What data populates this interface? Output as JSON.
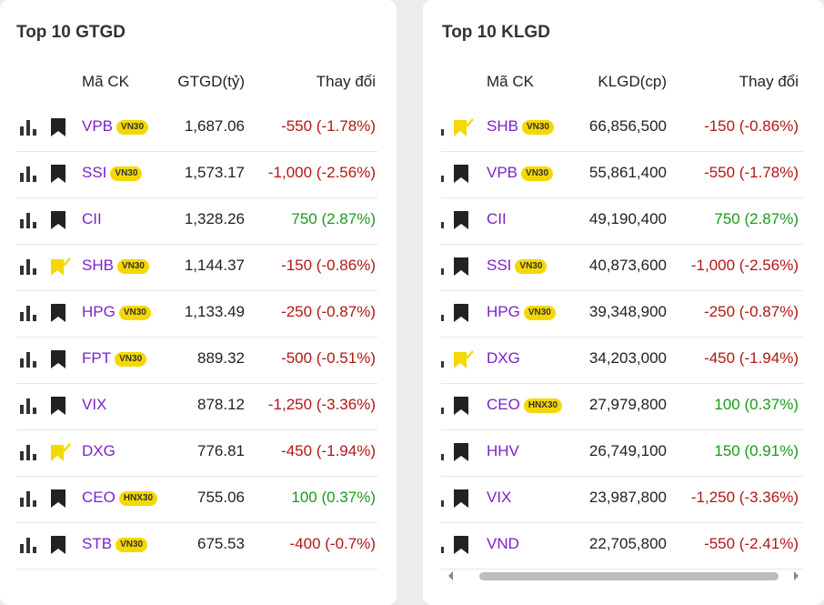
{
  "left": {
    "title": "Top 10 GTGD",
    "headers": {
      "sym": "Mã CK",
      "value": "GTGD(tỷ)",
      "change": "Thay đổi"
    },
    "rows": [
      {
        "sym": "VPB",
        "badge": "VN30",
        "value": "1,687.06",
        "change": "-550 (-1.78%)",
        "dir": "down",
        "bookmark": "normal"
      },
      {
        "sym": "SSI",
        "badge": "VN30",
        "value": "1,573.17",
        "change": "-1,000 (-2.56%)",
        "dir": "down",
        "bookmark": "normal"
      },
      {
        "sym": "CII",
        "badge": "",
        "value": "1,328.26",
        "change": "750 (2.87%)",
        "dir": "up",
        "bookmark": "normal"
      },
      {
        "sym": "SHB",
        "badge": "VN30",
        "value": "1,144.37",
        "change": "-150 (-0.86%)",
        "dir": "down",
        "bookmark": "checked"
      },
      {
        "sym": "HPG",
        "badge": "VN30",
        "value": "1,133.49",
        "change": "-250 (-0.87%)",
        "dir": "down",
        "bookmark": "normal"
      },
      {
        "sym": "FPT",
        "badge": "VN30",
        "value": "889.32",
        "change": "-500 (-0.51%)",
        "dir": "down",
        "bookmark": "normal"
      },
      {
        "sym": "VIX",
        "badge": "",
        "value": "878.12",
        "change": "-1,250 (-3.36%)",
        "dir": "down",
        "bookmark": "normal"
      },
      {
        "sym": "DXG",
        "badge": "",
        "value": "776.81",
        "change": "-450 (-1.94%)",
        "dir": "down",
        "bookmark": "checked"
      },
      {
        "sym": "CEO",
        "badge": "HNX30",
        "value": "755.06",
        "change": "100 (0.37%)",
        "dir": "up",
        "bookmark": "normal"
      },
      {
        "sym": "STB",
        "badge": "VN30",
        "value": "675.53",
        "change": "-400 (-0.7%)",
        "dir": "down",
        "bookmark": "normal"
      }
    ]
  },
  "right": {
    "title": "Top 10 KLGD",
    "headers": {
      "sym": "Mã CK",
      "value": "KLGD(cp)",
      "change": "Thay đổi"
    },
    "rows": [
      {
        "sym": "SHB",
        "badge": "VN30",
        "value": "66,856,500",
        "change": "-150 (-0.86%)",
        "dir": "down",
        "bookmark": "checked"
      },
      {
        "sym": "VPB",
        "badge": "VN30",
        "value": "55,861,400",
        "change": "-550 (-1.78%)",
        "dir": "down",
        "bookmark": "normal"
      },
      {
        "sym": "CII",
        "badge": "",
        "value": "49,190,400",
        "change": "750 (2.87%)",
        "dir": "up",
        "bookmark": "normal"
      },
      {
        "sym": "SSI",
        "badge": "VN30",
        "value": "40,873,600",
        "change": "-1,000 (-2.56%)",
        "dir": "down",
        "bookmark": "normal"
      },
      {
        "sym": "HPG",
        "badge": "VN30",
        "value": "39,348,900",
        "change": "-250 (-0.87%)",
        "dir": "down",
        "bookmark": "normal"
      },
      {
        "sym": "DXG",
        "badge": "",
        "value": "34,203,000",
        "change": "-450 (-1.94%)",
        "dir": "down",
        "bookmark": "checked"
      },
      {
        "sym": "CEO",
        "badge": "HNX30",
        "value": "27,979,800",
        "change": "100 (0.37%)",
        "dir": "up",
        "bookmark": "normal"
      },
      {
        "sym": "HHV",
        "badge": "",
        "value": "26,749,100",
        "change": "150 (0.91%)",
        "dir": "up",
        "bookmark": "normal"
      },
      {
        "sym": "VIX",
        "badge": "",
        "value": "23,987,800",
        "change": "-1,250 (-3.36%)",
        "dir": "down",
        "bookmark": "normal"
      },
      {
        "sym": "VND",
        "badge": "",
        "value": "22,705,800",
        "change": "-550 (-2.41%)",
        "dir": "down",
        "bookmark": "normal"
      }
    ]
  },
  "colors": {
    "up": "#1a9a1a",
    "down": "#b31515",
    "symbol": "#7b22c9",
    "badge": "#f5d800",
    "bookmark_checked": "#f5d800"
  },
  "icons": {
    "chart": "bar-chart-icon",
    "bookmark": "bookmark-icon",
    "bookmark_checked": "bookmark-checked-icon"
  }
}
